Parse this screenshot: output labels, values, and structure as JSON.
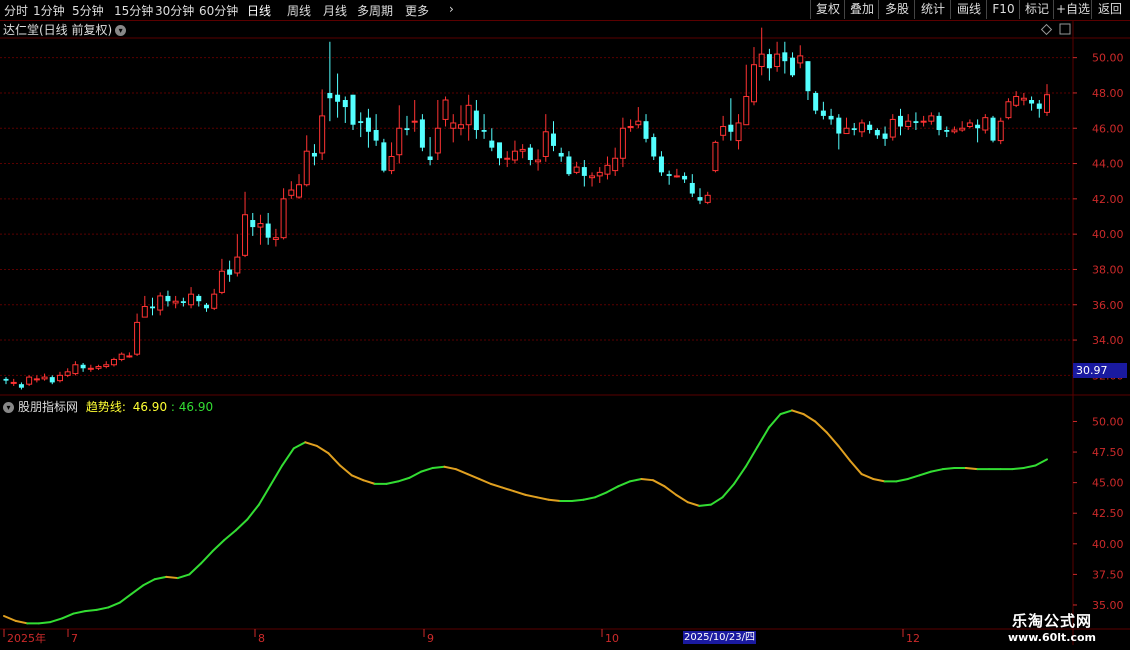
{
  "toolbar": {
    "periods": [
      "分时",
      "1分钟",
      "5分钟",
      "15分钟",
      "30分钟",
      "60分钟",
      "日线",
      "周线",
      "月线",
      "多周期",
      "更多"
    ],
    "active": "日线",
    "more_arrow": "›",
    "buttons": [
      "复权",
      "叠加",
      "多股",
      "统计",
      "画线",
      "F10",
      "标记",
      "+自选",
      "返回"
    ]
  },
  "main_panel": {
    "title": "达仁堂(日线 前复权)",
    "last_price_tag": "30.97",
    "icons": [
      "chevron-down-icon",
      "diamond-icon",
      "panel-toggle-icon"
    ]
  },
  "indicator_panel": {
    "name": "股朋指标网",
    "line_label": "趋势线:",
    "value_yellow": "46.90",
    "value_green": ": 46.90"
  },
  "x_axis": {
    "labels": [
      "2025年",
      "7",
      "8",
      "9",
      "10",
      "12"
    ],
    "cursor_date": "2025/10/23/四"
  },
  "watermark": {
    "line1": "乐淘公式网",
    "line2": "www.60lt.com"
  },
  "colors": {
    "up": "#ff3333",
    "down": "#54ffff",
    "trend_up": "#33dd33",
    "trend_down": "#e0a020",
    "grid": "#5a0000",
    "axis": "#cc2a2a"
  },
  "chart_data": [
    {
      "type": "candlestick",
      "title": "达仁堂(日线 前复权)",
      "ylim": [
        31,
        51
      ],
      "yticks": [
        "50.00",
        "48.00",
        "46.00",
        "44.00",
        "42.00",
        "40.00",
        "38.00",
        "36.00",
        "34.00",
        "32.00"
      ],
      "candles": [
        [
          31.8,
          31.7,
          31.9,
          31.5
        ],
        [
          31.6,
          31.6,
          31.8,
          31.4
        ],
        [
          31.5,
          31.3,
          31.6,
          31.2
        ],
        [
          31.5,
          31.9,
          32.0,
          31.4
        ],
        [
          31.8,
          31.8,
          32.0,
          31.6
        ],
        [
          31.8,
          31.9,
          32.1,
          31.7
        ],
        [
          31.9,
          31.6,
          32.0,
          31.5
        ],
        [
          31.7,
          32.0,
          32.2,
          31.6
        ],
        [
          32.0,
          32.2,
          32.4,
          31.9
        ],
        [
          32.1,
          32.6,
          32.8,
          32.0
        ],
        [
          32.6,
          32.4,
          32.7,
          32.2
        ],
        [
          32.4,
          32.4,
          32.6,
          32.2
        ],
        [
          32.4,
          32.5,
          32.6,
          32.3
        ],
        [
          32.5,
          32.6,
          32.8,
          32.4
        ],
        [
          32.6,
          32.9,
          33.0,
          32.5
        ],
        [
          32.9,
          33.2,
          33.3,
          32.8
        ],
        [
          33.1,
          33.1,
          33.3,
          33.0
        ],
        [
          33.2,
          35.0,
          35.5,
          33.1
        ],
        [
          35.3,
          35.9,
          36.5,
          35.3
        ],
        [
          35.9,
          35.8,
          36.4,
          35.4
        ],
        [
          35.7,
          36.5,
          36.7,
          35.4
        ],
        [
          36.5,
          36.2,
          36.8,
          35.9
        ],
        [
          36.1,
          36.2,
          36.5,
          35.8
        ],
        [
          36.2,
          36.1,
          36.4,
          35.9
        ],
        [
          36.0,
          36.6,
          37.0,
          35.8
        ],
        [
          36.5,
          36.2,
          36.6,
          35.9
        ],
        [
          36.0,
          35.8,
          36.1,
          35.6
        ],
        [
          35.8,
          36.6,
          36.9,
          35.7
        ],
        [
          36.7,
          37.9,
          38.6,
          36.6
        ],
        [
          38.0,
          37.7,
          38.5,
          37.3
        ],
        [
          37.8,
          38.7,
          40.0,
          37.6
        ],
        [
          38.8,
          41.1,
          42.4,
          38.7
        ],
        [
          40.8,
          40.4,
          41.2,
          39.9
        ],
        [
          40.4,
          40.6,
          41.1,
          39.4
        ],
        [
          40.6,
          39.8,
          41.2,
          39.4
        ],
        [
          39.7,
          39.8,
          40.3,
          39.3
        ],
        [
          39.8,
          42.0,
          42.6,
          39.7
        ],
        [
          42.2,
          42.5,
          43.0,
          42.0
        ],
        [
          42.1,
          42.8,
          43.4,
          42.0
        ],
        [
          42.8,
          44.7,
          45.6,
          42.7
        ],
        [
          44.6,
          44.4,
          45.1,
          43.9
        ],
        [
          44.6,
          46.7,
          48.2,
          44.2
        ],
        [
          48.0,
          47.7,
          50.9,
          46.4
        ],
        [
          47.9,
          47.5,
          49.1,
          46.6
        ],
        [
          47.6,
          47.2,
          47.8,
          46.3
        ],
        [
          47.9,
          46.2,
          47.9,
          45.9
        ],
        [
          46.4,
          46.3,
          46.9,
          45.5
        ],
        [
          46.6,
          45.8,
          47.1,
          44.9
        ],
        [
          45.9,
          45.3,
          46.8,
          45.0
        ],
        [
          45.2,
          43.6,
          45.4,
          43.5
        ],
        [
          43.6,
          44.4,
          45.2,
          43.4
        ],
        [
          44.5,
          46.0,
          47.3,
          44.0
        ],
        [
          46.0,
          45.9,
          46.7,
          45.6
        ],
        [
          46.4,
          46.4,
          47.6,
          45.8
        ],
        [
          46.5,
          44.9,
          46.8,
          44.7
        ],
        [
          44.4,
          44.2,
          45.5,
          43.9
        ],
        [
          44.6,
          46.0,
          47.6,
          44.2
        ],
        [
          46.5,
          47.6,
          47.8,
          46.1
        ],
        [
          46.0,
          46.3,
          46.8,
          45.2
        ],
        [
          46.0,
          46.2,
          47.3,
          45.6
        ],
        [
          46.2,
          47.3,
          47.9,
          45.3
        ],
        [
          47.0,
          45.9,
          47.6,
          45.4
        ],
        [
          45.9,
          45.8,
          46.8,
          45.4
        ],
        [
          45.3,
          44.9,
          46.0,
          44.7
        ],
        [
          45.2,
          44.3,
          44.9,
          43.9
        ],
        [
          44.3,
          44.3,
          44.7,
          43.8
        ],
        [
          44.2,
          44.7,
          45.3,
          44.0
        ],
        [
          44.7,
          44.8,
          45.1,
          44.3
        ],
        [
          44.9,
          44.2,
          45.1,
          43.9
        ],
        [
          44.1,
          44.2,
          44.8,
          43.6
        ],
        [
          44.4,
          45.8,
          46.8,
          44.1
        ],
        [
          45.7,
          45.0,
          46.4,
          44.7
        ],
        [
          44.6,
          44.4,
          44.9,
          44.1
        ],
        [
          44.4,
          43.4,
          44.7,
          43.3
        ],
        [
          43.5,
          43.8,
          44.1,
          43.4
        ],
        [
          43.8,
          43.3,
          44.2,
          42.7
        ],
        [
          43.2,
          43.3,
          43.5,
          42.7
        ],
        [
          43.3,
          43.5,
          43.8,
          42.9
        ],
        [
          43.4,
          43.9,
          44.4,
          43.1
        ],
        [
          43.6,
          44.3,
          44.9,
          43.3
        ],
        [
          44.3,
          46.0,
          46.6,
          43.8
        ],
        [
          46.1,
          46.1,
          46.5,
          45.8
        ],
        [
          46.2,
          46.4,
          47.2,
          46.0
        ],
        [
          46.4,
          45.4,
          46.8,
          45.2
        ],
        [
          45.5,
          44.4,
          45.7,
          44.2
        ],
        [
          44.4,
          43.5,
          44.7,
          43.3
        ],
        [
          43.4,
          43.3,
          43.6,
          42.8
        ],
        [
          43.3,
          43.3,
          43.7,
          43.2
        ],
        [
          43.3,
          43.1,
          43.5,
          42.9
        ],
        [
          42.9,
          42.3,
          43.4,
          42.1
        ],
        [
          42.1,
          41.9,
          42.6,
          41.7
        ],
        [
          41.8,
          42.2,
          42.4,
          41.7
        ],
        [
          43.6,
          45.2,
          45.3,
          43.5
        ],
        [
          45.6,
          46.1,
          46.7,
          45.3
        ],
        [
          46.2,
          45.8,
          47.7,
          45.3
        ],
        [
          45.3,
          46.3,
          46.8,
          44.8
        ],
        [
          46.2,
          47.8,
          49.6,
          46.2
        ],
        [
          47.5,
          49.6,
          50.6,
          47.3
        ],
        [
          49.5,
          50.2,
          51.7,
          49.0
        ],
        [
          50.2,
          49.4,
          50.5,
          48.7
        ],
        [
          49.5,
          50.2,
          50.9,
          49.2
        ],
        [
          50.3,
          49.8,
          50.9,
          49.1
        ],
        [
          50.0,
          49.0,
          50.3,
          48.9
        ],
        [
          49.7,
          50.1,
          50.7,
          49.4
        ],
        [
          49.8,
          48.1,
          49.8,
          47.6
        ],
        [
          48.0,
          47.0,
          48.1,
          46.8
        ],
        [
          47.0,
          46.7,
          47.5,
          46.5
        ],
        [
          46.7,
          46.5,
          47.1,
          46.2
        ],
        [
          46.6,
          45.7,
          46.8,
          44.8
        ],
        [
          45.7,
          46.0,
          46.6,
          45.7
        ],
        [
          46.0,
          45.9,
          46.3,
          45.6
        ],
        [
          45.8,
          46.3,
          46.5,
          45.5
        ],
        [
          46.2,
          45.9,
          46.4,
          45.7
        ],
        [
          45.9,
          45.6,
          46.0,
          45.4
        ],
        [
          45.7,
          45.4,
          46.1,
          45.0
        ],
        [
          45.5,
          46.5,
          46.8,
          45.3
        ],
        [
          46.7,
          46.1,
          47.1,
          45.6
        ],
        [
          46.1,
          46.4,
          46.8,
          45.9
        ],
        [
          46.4,
          46.3,
          46.9,
          45.9
        ],
        [
          46.4,
          46.4,
          46.7,
          46.1
        ],
        [
          46.4,
          46.7,
          46.9,
          46.2
        ],
        [
          46.7,
          45.9,
          46.9,
          45.6
        ],
        [
          45.9,
          45.8,
          46.1,
          45.5
        ],
        [
          45.8,
          45.9,
          46.1,
          45.7
        ],
        [
          45.9,
          46.0,
          46.4,
          45.8
        ],
        [
          46.1,
          46.3,
          46.5,
          46.0
        ],
        [
          46.2,
          46.0,
          46.5,
          45.2
        ],
        [
          45.9,
          46.6,
          46.8,
          45.7
        ],
        [
          46.6,
          45.3,
          46.7,
          45.2
        ],
        [
          45.3,
          46.4,
          46.6,
          45.1
        ],
        [
          46.6,
          47.5,
          47.7,
          46.5
        ],
        [
          47.3,
          47.8,
          48.1,
          47.2
        ],
        [
          47.6,
          47.7,
          48.0,
          47.3
        ],
        [
          47.6,
          47.4,
          47.8,
          47.0
        ],
        [
          47.4,
          47.1,
          47.6,
          46.6
        ],
        [
          46.9,
          47.9,
          48.5,
          46.7
        ]
      ]
    },
    {
      "type": "line",
      "title": "股朋指标网",
      "ylim": [
        33.2,
        52
      ],
      "yticks": [
        "50.00",
        "47.50",
        "45.00",
        "42.50",
        "40.00",
        "37.50",
        "35.00"
      ],
      "series": [
        {
          "name": "趋势线",
          "values": [
            34.1,
            33.7,
            33.5,
            33.5,
            33.6,
            33.9,
            34.3,
            34.5,
            34.6,
            34.8,
            35.2,
            35.9,
            36.6,
            37.1,
            37.3,
            37.2,
            37.5,
            38.4,
            39.4,
            40.3,
            41.1,
            42.0,
            43.2,
            44.8,
            46.4,
            47.8,
            48.3,
            48.0,
            47.4,
            46.4,
            45.6,
            45.2,
            44.9,
            44.9,
            45.1,
            45.4,
            45.9,
            46.2,
            46.3,
            46.1,
            45.7,
            45.3,
            44.9,
            44.6,
            44.3,
            44.0,
            43.8,
            43.6,
            43.5,
            43.5,
            43.6,
            43.8,
            44.2,
            44.7,
            45.1,
            45.3,
            45.2,
            44.7,
            44.0,
            43.4,
            43.1,
            43.2,
            43.8,
            44.9,
            46.3,
            47.9,
            49.5,
            50.6,
            50.9,
            50.6,
            50.0,
            49.1,
            48.0,
            46.8,
            45.7,
            45.3,
            45.1,
            45.1,
            45.3,
            45.6,
            45.9,
            46.1,
            46.2,
            46.2,
            46.1,
            46.1,
            46.1,
            46.1,
            46.2,
            46.4,
            46.9
          ]
        }
      ]
    }
  ]
}
